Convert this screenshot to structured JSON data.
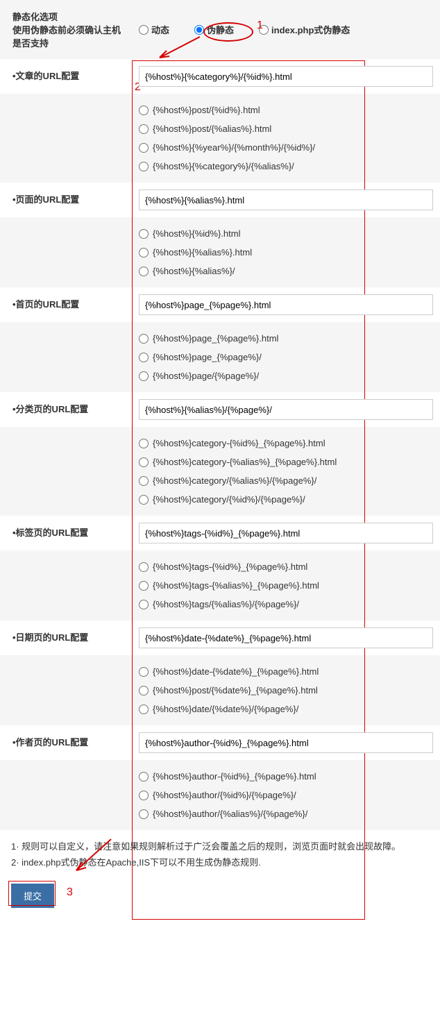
{
  "header": {
    "title": "静态化选项",
    "subtitle": "使用伪静态前必须确认主机是否支持",
    "radios": {
      "dynamic": "动态",
      "pseudo": "伪静态",
      "indexphp": "index.php式伪静态"
    }
  },
  "sections": [
    {
      "label": "•文章的URL配置",
      "input": "{%host%}{%category%}/{%id%}.html",
      "options": [
        "{%host%}post/{%id%}.html",
        "{%host%}post/{%alias%}.html",
        "{%host%}{%year%}/{%month%}/{%id%}/",
        "{%host%}{%category%}/{%alias%}/"
      ]
    },
    {
      "label": "•页面的URL配置",
      "input": "{%host%}{%alias%}.html",
      "options": [
        "{%host%}{%id%}.html",
        "{%host%}{%alias%}.html",
        "{%host%}{%alias%}/"
      ]
    },
    {
      "label": "•首页的URL配置",
      "input": "{%host%}page_{%page%}.html",
      "options": [
        "{%host%}page_{%page%}.html",
        "{%host%}page_{%page%}/",
        "{%host%}page/{%page%}/"
      ]
    },
    {
      "label": "•分类页的URL配置",
      "input": "{%host%}{%alias%}/{%page%}/",
      "options": [
        "{%host%}category-{%id%}_{%page%}.html",
        "{%host%}category-{%alias%}_{%page%}.html",
        "{%host%}category/{%alias%}/{%page%}/",
        "{%host%}category/{%id%}/{%page%}/"
      ]
    },
    {
      "label": "•标签页的URL配置",
      "input": "{%host%}tags-{%id%}_{%page%}.html",
      "options": [
        "{%host%}tags-{%id%}_{%page%}.html",
        "{%host%}tags-{%alias%}_{%page%}.html",
        "{%host%}tags/{%alias%}/{%page%}/"
      ]
    },
    {
      "label": "•日期页的URL配置",
      "input": "{%host%}date-{%date%}_{%page%}.html",
      "options": [
        "{%host%}date-{%date%}_{%page%}.html",
        "{%host%}post/{%date%}_{%page%}.html",
        "{%host%}date/{%date%}/{%page%}/"
      ]
    },
    {
      "label": "•作者页的URL配置",
      "input": "{%host%}author-{%id%}_{%page%}.html",
      "options": [
        "{%host%}author-{%id%}_{%page%}.html",
        "{%host%}author/{%id%}/{%page%}/",
        "{%host%}author/{%alias%}/{%page%}/"
      ]
    }
  ],
  "notes": {
    "line1": "1· 规则可以自定义，请注意如果规则解析过于广泛会覆盖之后的规则，浏览页面时就会出现故障。",
    "line2": "2· index.php式伪静态在Apache,IIS下可以不用生成伪静态规则."
  },
  "submit": "提交",
  "anno": {
    "n1": "1",
    "n2": "2",
    "n3": "3"
  }
}
